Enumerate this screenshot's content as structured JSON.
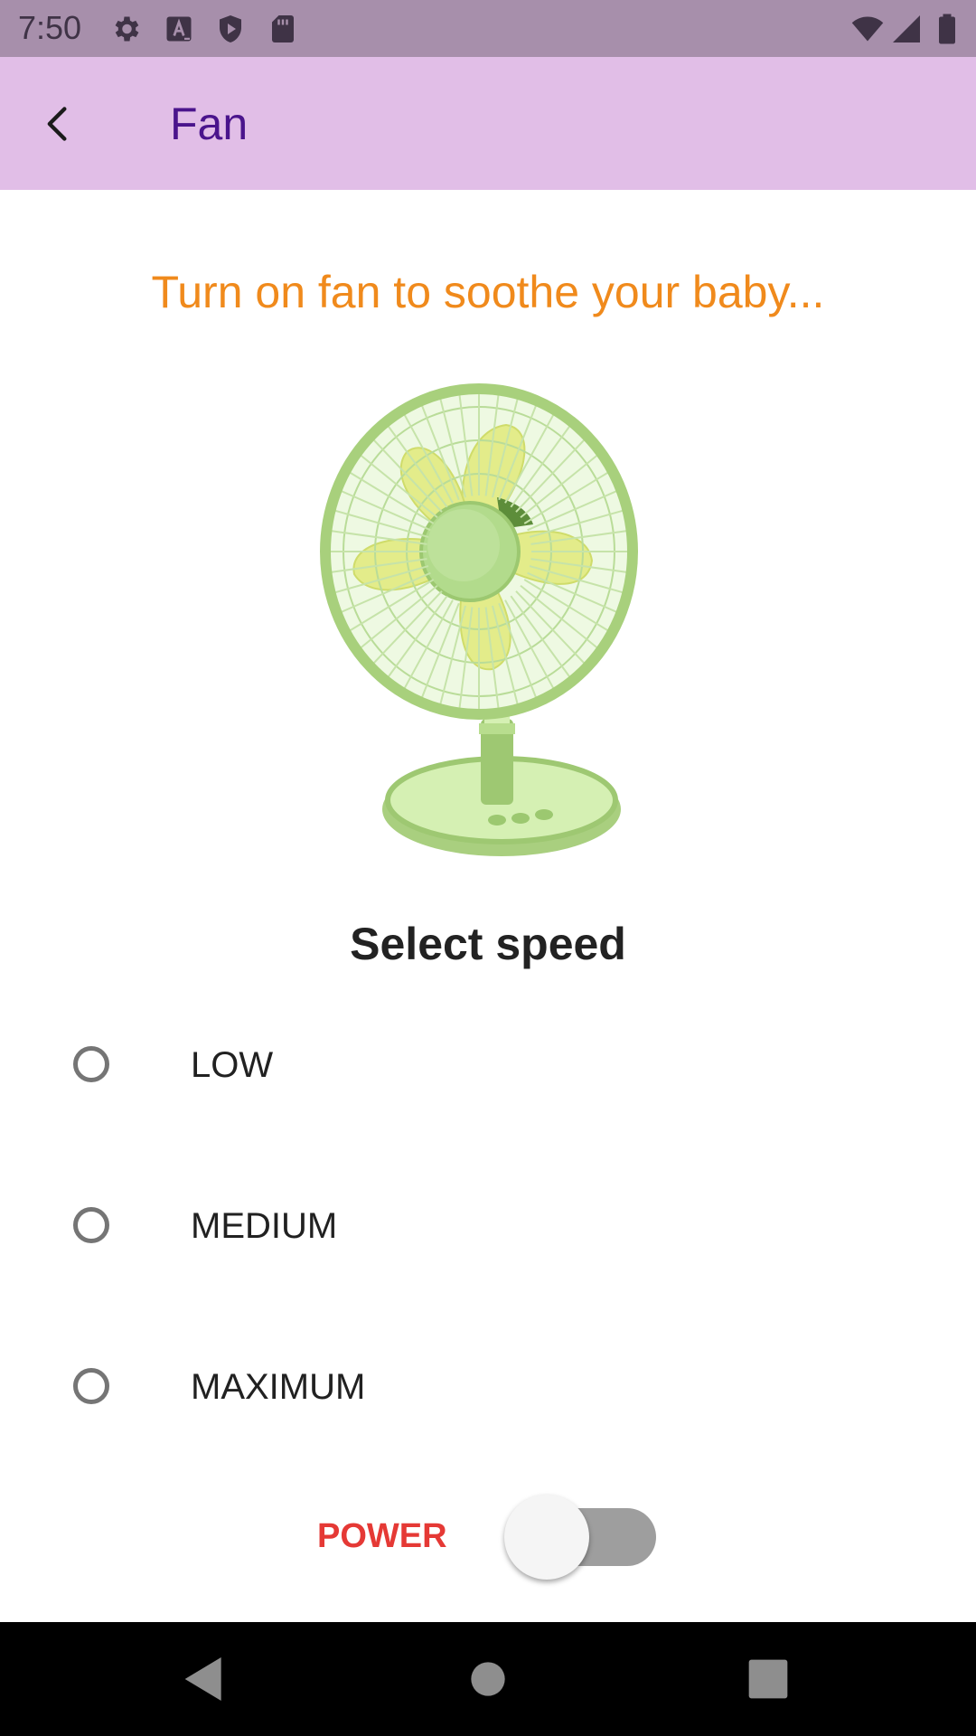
{
  "status_bar": {
    "time": "7:50",
    "icons_left": [
      "gear-icon",
      "font-a-icon",
      "shield-play-icon",
      "sd-card-icon"
    ],
    "icons_right": [
      "wifi-icon",
      "signal-icon",
      "battery-icon"
    ],
    "background": "#a78fab"
  },
  "app_bar": {
    "title": "Fan",
    "back_icon": "chevron-left-icon",
    "background": "#e1bee7",
    "title_color": "#4a148c"
  },
  "main": {
    "subtitle": "Turn on fan to soothe your baby...",
    "subtitle_color": "#f08a1c",
    "image": "fan-illustration",
    "section_title": "Select speed",
    "speed_options": [
      {
        "label": "LOW",
        "selected": false
      },
      {
        "label": "MEDIUM",
        "selected": false
      },
      {
        "label": "MAXIMUM",
        "selected": false
      }
    ],
    "power": {
      "label": "POWER",
      "on": false,
      "label_color": "#e53935"
    }
  },
  "nav_bar": {
    "buttons": [
      "back-triangle-icon",
      "home-circle-icon",
      "recents-square-icon"
    ]
  }
}
